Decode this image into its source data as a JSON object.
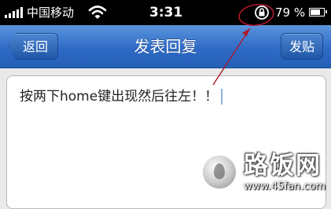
{
  "status_bar": {
    "carrier": "中国移动",
    "time": "3:31",
    "battery_text": "79 %",
    "battery_level": 0.79,
    "icons": [
      "signal-icon",
      "wifi-icon",
      "rotation-lock-icon",
      "battery-icon"
    ]
  },
  "nav": {
    "back_label": "返回",
    "title": "发表回复",
    "post_label": "发贴"
  },
  "reply": {
    "value": "按两下home键出现然后往左！！"
  },
  "watermark": {
    "title": "路饭网",
    "url": "www.45fan.com"
  },
  "colors": {
    "nav_blue": "#2f6bc6",
    "annotation_red": "#b0182a"
  }
}
